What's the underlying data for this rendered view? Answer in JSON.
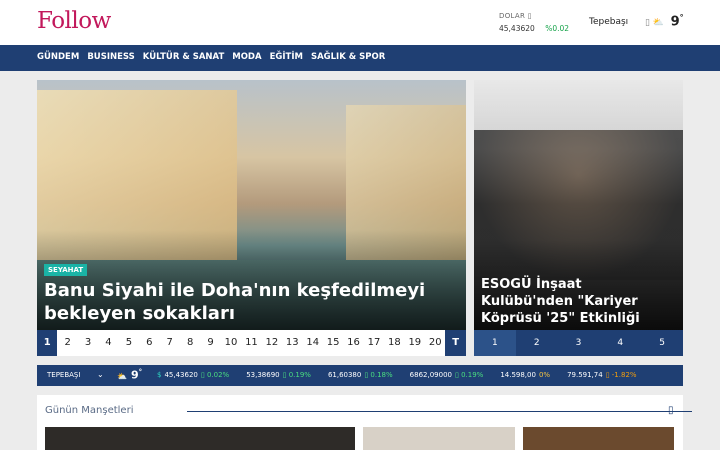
{
  "header": {
    "logo": "Follow",
    "currency": {
      "label": "DOLAR",
      "value": "45,43620",
      "change": "%0.02"
    },
    "city": "Tepebaşı",
    "weather": {
      "temp": "9",
      "deg": "°"
    }
  },
  "nav": {
    "items": [
      "GÜNDEM",
      "BUSINESS",
      "KÜLTÜR & SANAT",
      "MODA",
      "EĞİTİM",
      "SAĞLIK & SPOR"
    ],
    "tools": [
      "",
      ""
    ]
  },
  "main_slider": {
    "tag": "SEYAHAT",
    "title": "Banu Siyahi ile Doha'nın keşfedilmeyi bekleyen sokakları",
    "pages": [
      "1",
      "2",
      "3",
      "4",
      "5",
      "6",
      "7",
      "8",
      "9",
      "10",
      "11",
      "12",
      "13",
      "14",
      "15",
      "16",
      "17",
      "18",
      "19",
      "20",
      "T"
    ]
  },
  "side_slider": {
    "title": "ESOGÜ İnşaat Kulübü'nden \"Kariyer Köprüsü '25\" Etkinliği",
    "pages": [
      "1",
      "2",
      "3",
      "4",
      "5"
    ]
  },
  "ticker": {
    "city": "TEPEBAŞI",
    "temp": "9",
    "deg": "°",
    "quotes": [
      {
        "icon": "$",
        "value": "45,43620",
        "change": "0.02%",
        "dir": "pos"
      },
      {
        "icon": "",
        "value": "53,38690",
        "change": "0.19%",
        "dir": "pos"
      },
      {
        "icon": "",
        "value": "61,60380",
        "change": "0.18%",
        "dir": "pos"
      },
      {
        "icon": "",
        "value": "6862,09000",
        "change": "0.19%",
        "dir": "pos"
      },
      {
        "icon": "",
        "value": "14.598,00",
        "change": "0%",
        "dir": "zero"
      },
      {
        "icon": "",
        "value": "79.591,74",
        "change": "-1.82%",
        "dir": "neg"
      }
    ]
  },
  "headlines": {
    "label": "Günün Manşetleri",
    "thumb_colors": [
      "#2e2b28",
      "#d8d1c7",
      "#6b4a2e"
    ]
  }
}
